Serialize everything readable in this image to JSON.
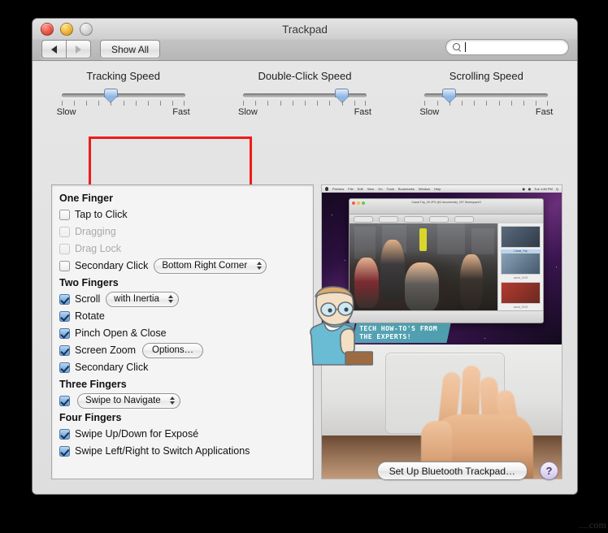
{
  "window": {
    "title": "Trackpad",
    "traffic_lights": [
      "close",
      "minimize",
      "zoom"
    ],
    "toolbar": {
      "back_label": "◀",
      "forward_label": "▶",
      "show_all_label": "Show All",
      "search_placeholder": "",
      "search_value": ""
    }
  },
  "sliders": [
    {
      "id": "tracking-speed",
      "title": "Tracking Speed",
      "min_label": "Slow",
      "max_label": "Fast",
      "ticks": 11,
      "value": 4,
      "max": 10,
      "highlighted": true
    },
    {
      "id": "double-click-speed",
      "title": "Double-Click Speed",
      "min_label": "Slow",
      "max_label": "Fast",
      "ticks": 11,
      "value": 8,
      "max": 10,
      "highlighted": false
    },
    {
      "id": "scrolling-speed",
      "title": "Scrolling Speed",
      "min_label": "Slow",
      "max_label": "Fast",
      "ticks": 11,
      "value": 2,
      "max": 10,
      "highlighted": false
    }
  ],
  "highlight_color": "#ee1b19",
  "groups": [
    {
      "heading": "One Finger",
      "rows": [
        {
          "label": "Tap to Click",
          "checked": false,
          "disabled": false
        },
        {
          "label": "Dragging",
          "checked": false,
          "disabled": true
        },
        {
          "label": "Drag Lock",
          "checked": false,
          "disabled": true
        },
        {
          "label": "Secondary Click",
          "checked": false,
          "disabled": false,
          "popup": "Bottom Right Corner"
        }
      ]
    },
    {
      "heading": "Two Fingers",
      "rows": [
        {
          "label": "Scroll",
          "checked": true,
          "disabled": false,
          "popup": "with Inertia"
        },
        {
          "label": "Rotate",
          "checked": true,
          "disabled": false
        },
        {
          "label": "Pinch Open & Close",
          "checked": true,
          "disabled": false
        },
        {
          "label": "Screen Zoom",
          "checked": true,
          "disabled": false,
          "button": "Options…"
        },
        {
          "label": "Secondary Click",
          "checked": true,
          "disabled": false
        }
      ]
    },
    {
      "heading": "Three Fingers",
      "rows": [
        {
          "label": "",
          "checked": true,
          "disabled": false,
          "popup": "Swipe to Navigate"
        }
      ]
    },
    {
      "heading": "Four Fingers",
      "rows": [
        {
          "label": "Swipe Up/Down for Exposé",
          "checked": true,
          "disabled": false
        },
        {
          "label": "Swipe Left/Right to Switch Applications",
          "checked": true,
          "disabled": false
        }
      ]
    }
  ],
  "preview": {
    "name": "trackpad-gesture-demo-video",
    "overlay_caption": "TECH HOW-TO'S FROM\nTHE EXPERTS!",
    "inner_window_title": "Canal Trip_25.JPG (64 documents), 297 Workspace3"
  },
  "footer": {
    "bluetooth_button": "Set Up Bluetooth Trackpad…",
    "help_button": "?"
  },
  "watermark": "....com"
}
